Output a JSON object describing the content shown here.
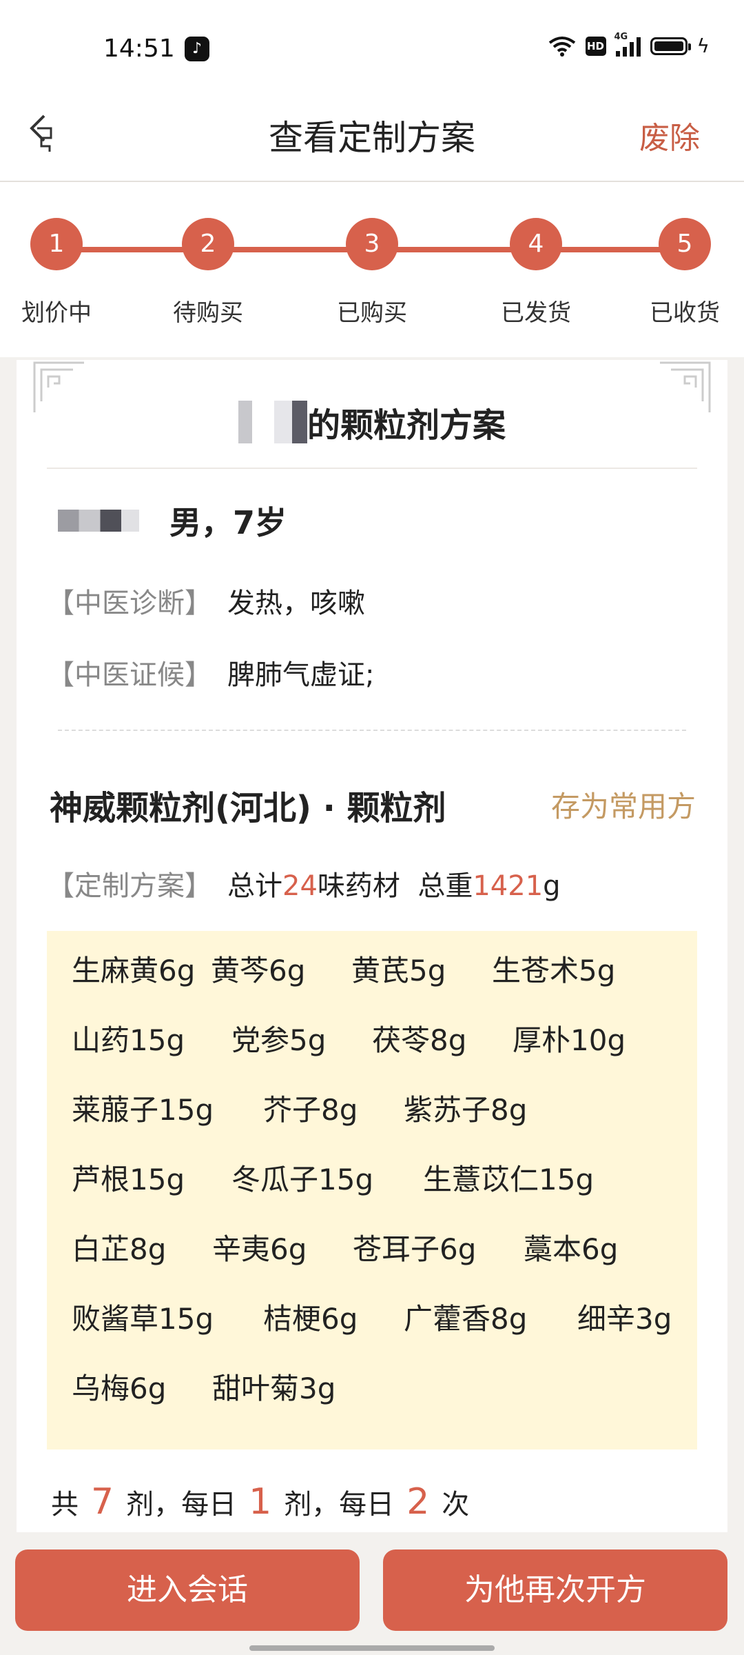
{
  "status_bar": {
    "time": "14:51",
    "app_icon": "tiktok-icon",
    "hd_badge": "HD",
    "network": "4G",
    "icons": [
      "wifi-icon",
      "hd-icon",
      "signal-icon",
      "battery-icon",
      "charging-icon"
    ]
  },
  "nav": {
    "back_icon": "back-arrow-icon",
    "title": "查看定制方案",
    "action": "废除"
  },
  "steps": [
    {
      "num": "1",
      "label": "划价中"
    },
    {
      "num": "2",
      "label": "待购买"
    },
    {
      "num": "3",
      "label": "已购买"
    },
    {
      "num": "4",
      "label": "已发货"
    },
    {
      "num": "5",
      "label": "已收货"
    }
  ],
  "card": {
    "title_suffix": "的颗粒剂方案",
    "patient_info": "男，7岁",
    "diagnosis_label": "【中医诊断】",
    "diagnosis_value": "发热，咳嗽",
    "syndrome_label": "【中医证候】",
    "syndrome_value": "脾肺气虚证;",
    "medicine_name": "神威颗粒剂(河北) · 颗粒剂",
    "save_favorite": "存为常用方",
    "plan_label": "【定制方案】",
    "plan_total_prefix": "总计",
    "plan_count": "24",
    "plan_count_suffix": "味药材",
    "plan_weight_prefix": "总重",
    "plan_weight": "1421",
    "plan_weight_unit": "g"
  },
  "herbs": {
    "row1": [
      "生麻黄6g",
      "黄芩6g",
      "黄芪5g",
      "生苍术5g"
    ],
    "row2": [
      "山药15g",
      "党参5g",
      "茯苓8g",
      "厚朴10g"
    ],
    "row3": [
      "莱菔子15g",
      "芥子8g",
      "紫苏子8g"
    ],
    "row4": [
      "芦根15g",
      "冬瓜子15g",
      "生薏苡仁15g"
    ],
    "row5": [
      "白芷8g",
      "辛夷6g",
      "苍耳子6g",
      "藁本6g"
    ],
    "row6": [
      "败酱草15g",
      "桔梗6g",
      "广藿香8g",
      "细辛3g"
    ],
    "row7": [
      "乌梅6g",
      "甜叶菊3g"
    ]
  },
  "dosage": {
    "prefix": "共",
    "doses": "7",
    "part1": "剂，每日",
    "per_day": "1",
    "part2": "剂，每日",
    "times": "2",
    "part3": "次"
  },
  "buttons": {
    "chat": "进入会话",
    "represcribe": "为他再次开方"
  },
  "colors": {
    "accent": "#d7614c",
    "gold": "#c49a63",
    "herb_bg": "#fff7d9"
  }
}
